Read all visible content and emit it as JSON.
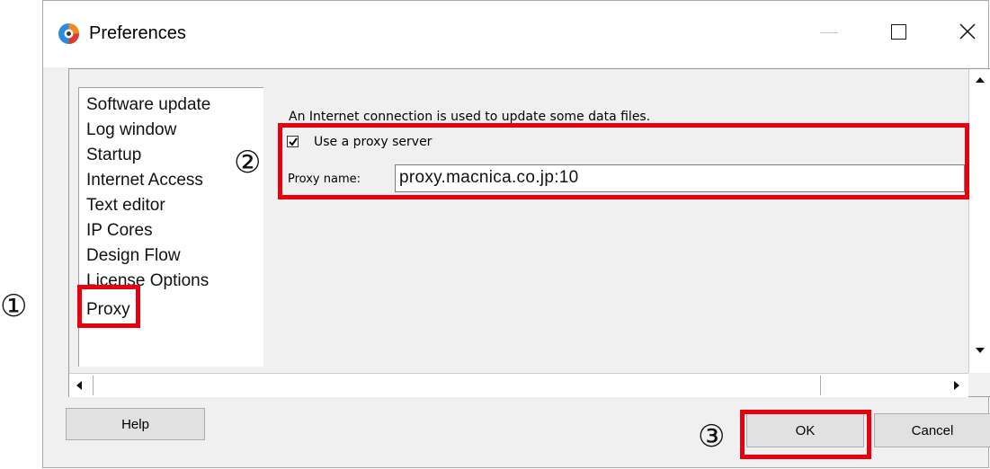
{
  "window": {
    "title": "Preferences",
    "icons": {
      "app": "app-logo-icon",
      "minimize": "minimize-icon",
      "maximize": "maximize-icon",
      "close": "close-icon"
    }
  },
  "sidebar": {
    "items": [
      {
        "label": "Software update"
      },
      {
        "label": "Log window"
      },
      {
        "label": "Startup"
      },
      {
        "label": "Internet Access"
      },
      {
        "label": "Text editor"
      },
      {
        "label": "IP Cores"
      },
      {
        "label": "Design Flow"
      },
      {
        "label": "License Options"
      },
      {
        "label": "Proxy",
        "selected": true
      }
    ]
  },
  "proxy_panel": {
    "intro": "An Internet connection is used to update some data files.",
    "use_proxy_label": "Use a proxy server",
    "use_proxy_checked": true,
    "proxy_name_label": "Proxy name:",
    "proxy_name_value": "proxy.macnica.co.jp:10"
  },
  "buttons": {
    "help": "Help",
    "ok": "OK",
    "cancel": "Cancel"
  },
  "annotations": {
    "marker1": "①",
    "marker2": "②",
    "marker3": "③",
    "color": "#e8000e"
  }
}
